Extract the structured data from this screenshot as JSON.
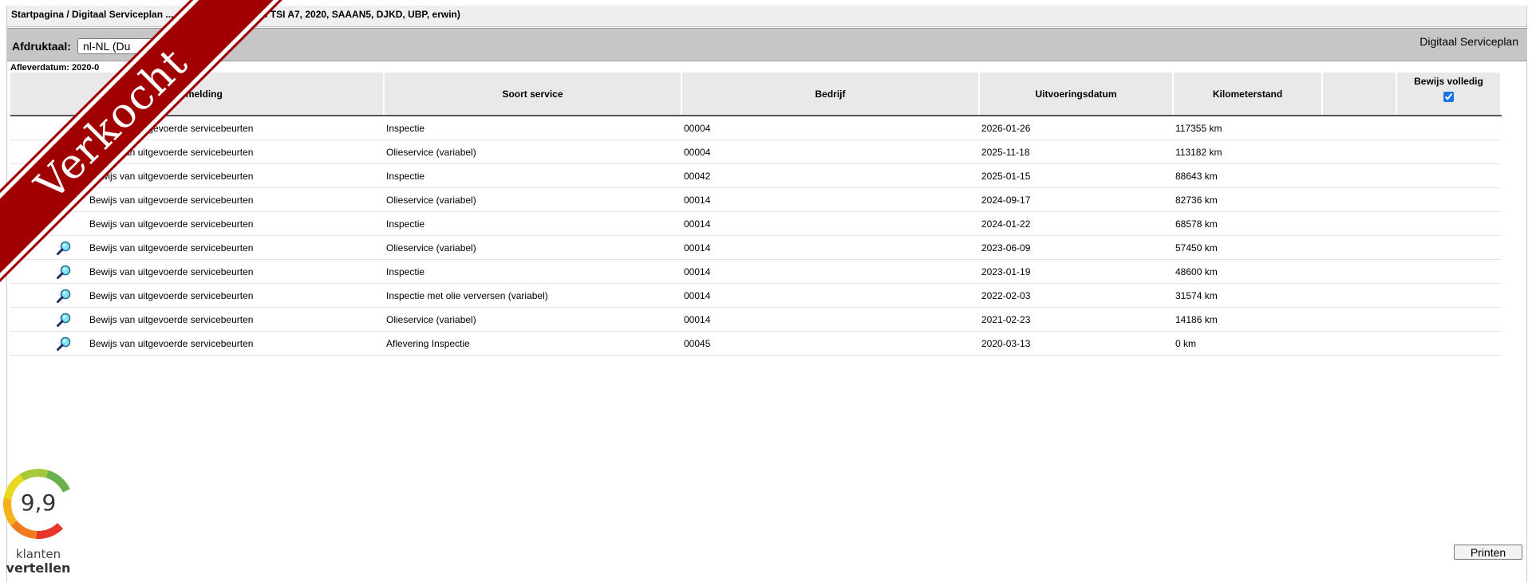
{
  "breadcrumb": "Startpagina / Digitaal Serviceplan ... , Caddy PV Basic 96 TSI A7, 2020, SAAAN5, DJKD, UBP, erwin)",
  "toolbar": {
    "print_language_label": "Afdruktaal:",
    "print_language_value": "nl-NL (Du",
    "page_heading": "Digitaal Serviceplan"
  },
  "delivery_date_label": "Afleverdatum: 2020-0",
  "table": {
    "headers": {
      "vermelding": "Vermelding",
      "soort": "Soort service",
      "bedrijf": "Bedrijf",
      "datum": "Uitvoeringsdatum",
      "km": "Kilometerstand",
      "proof": "Bewijs volledig"
    },
    "proof_all_checked": true,
    "rows": [
      {
        "icon": "",
        "vermelding": "Bewijs van uitgevoerde servicebeurten",
        "soort": "Inspectie",
        "bedrijf": "00004",
        "datum": "2026-01-26",
        "km": "117355 km"
      },
      {
        "icon": "",
        "vermelding": "Bewijs van uitgevoerde servicebeurten",
        "soort": "Olieservice (variabel)",
        "bedrijf": "00004",
        "datum": "2025-11-18",
        "km": "113182 km"
      },
      {
        "icon": "",
        "vermelding": "Bewijs van uitgevoerde servicebeurten",
        "soort": "Inspectie",
        "bedrijf": "00042",
        "datum": "2025-01-15",
        "km": "88643 km"
      },
      {
        "icon": "",
        "vermelding": "Bewijs van uitgevoerde servicebeurten",
        "soort": "Olieservice (variabel)",
        "bedrijf": "00014",
        "datum": "2024-09-17",
        "km": "82736 km"
      },
      {
        "icon": "",
        "vermelding": "Bewijs van uitgevoerde servicebeurten",
        "soort": "Inspectie",
        "bedrijf": "00014",
        "datum": "2024-01-22",
        "km": "68578 km"
      },
      {
        "icon": "magnifier-icon",
        "vermelding": "Bewijs van uitgevoerde servicebeurten",
        "soort": "Olieservice (variabel)",
        "bedrijf": "00014",
        "datum": "2023-06-09",
        "km": "57450 km"
      },
      {
        "icon": "magnifier-icon",
        "vermelding": "Bewijs van uitgevoerde servicebeurten",
        "soort": "Inspectie",
        "bedrijf": "00014",
        "datum": "2023-01-19",
        "km": "48600 km"
      },
      {
        "icon": "magnifier-icon",
        "vermelding": "Bewijs van uitgevoerde servicebeurten",
        "soort": "Inspectie met olie verversen (variabel)",
        "bedrijf": "00014",
        "datum": "2022-02-03",
        "km": "31574 km"
      },
      {
        "icon": "magnifier-icon",
        "vermelding": "Bewijs van uitgevoerde servicebeurten",
        "soort": "Olieservice (variabel)",
        "bedrijf": "00014",
        "datum": "2021-02-23",
        "km": "14186 km"
      },
      {
        "icon": "magnifier-icon",
        "vermelding": "Bewijs van uitgevoerde servicebeurten",
        "soort": "Aflevering Inspectie",
        "bedrijf": "00045",
        "datum": "2020-03-13",
        "km": "0 km"
      }
    ]
  },
  "print_button_label": "Printen",
  "sold_ribbon": "Verkocht",
  "rating": {
    "score": "9,9",
    "word1": "klanten",
    "word2": "vertellen",
    "colors": [
      "#e8342a",
      "#f07a1e",
      "#f5b21a",
      "#e8d820",
      "#a6c83c",
      "#6ab04c"
    ]
  }
}
